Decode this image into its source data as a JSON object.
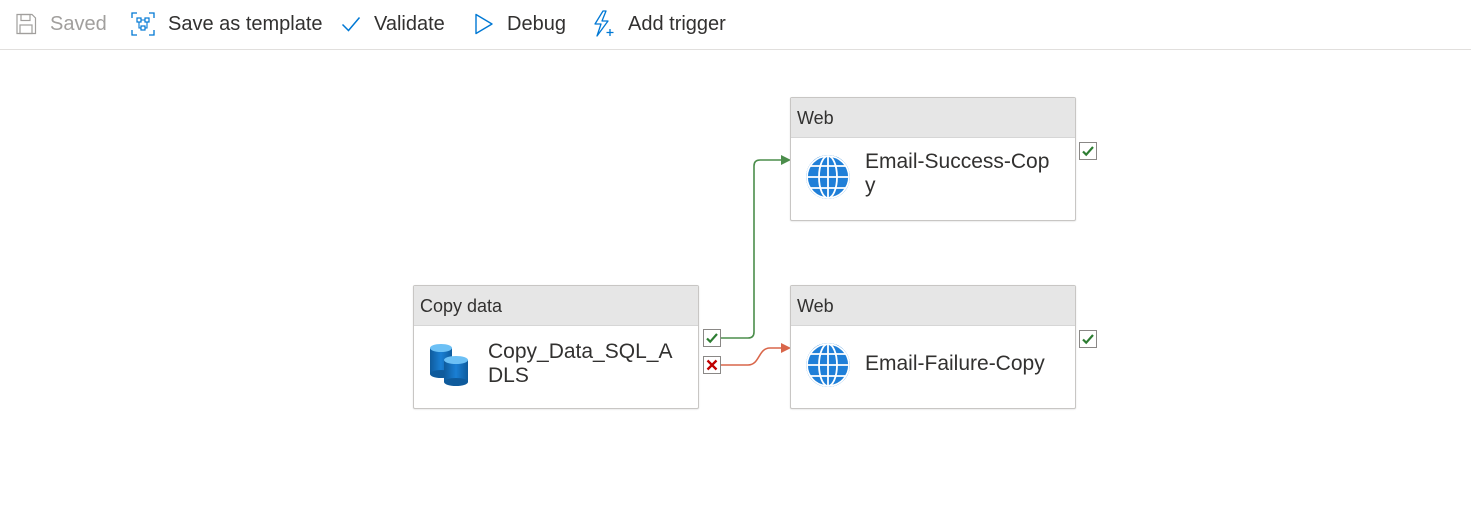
{
  "toolbar": {
    "save_label": "Saved",
    "template_label": "Save as template",
    "validate_label": "Validate",
    "debug_label": "Debug",
    "trigger_label": "Add trigger"
  },
  "activities": {
    "copy": {
      "type": "Copy data",
      "name": "Copy_Data_SQL_ADLS",
      "icon": "database-icon"
    },
    "success": {
      "type": "Web",
      "name": "Email-Success-Copy",
      "icon": "globe-icon"
    },
    "failure": {
      "type": "Web",
      "name": "Email-Failure-Copy",
      "icon": "globe-icon"
    }
  },
  "colors": {
    "success": "#4b8d4b",
    "failure": "#d9664a",
    "accent": "#0078d4"
  }
}
